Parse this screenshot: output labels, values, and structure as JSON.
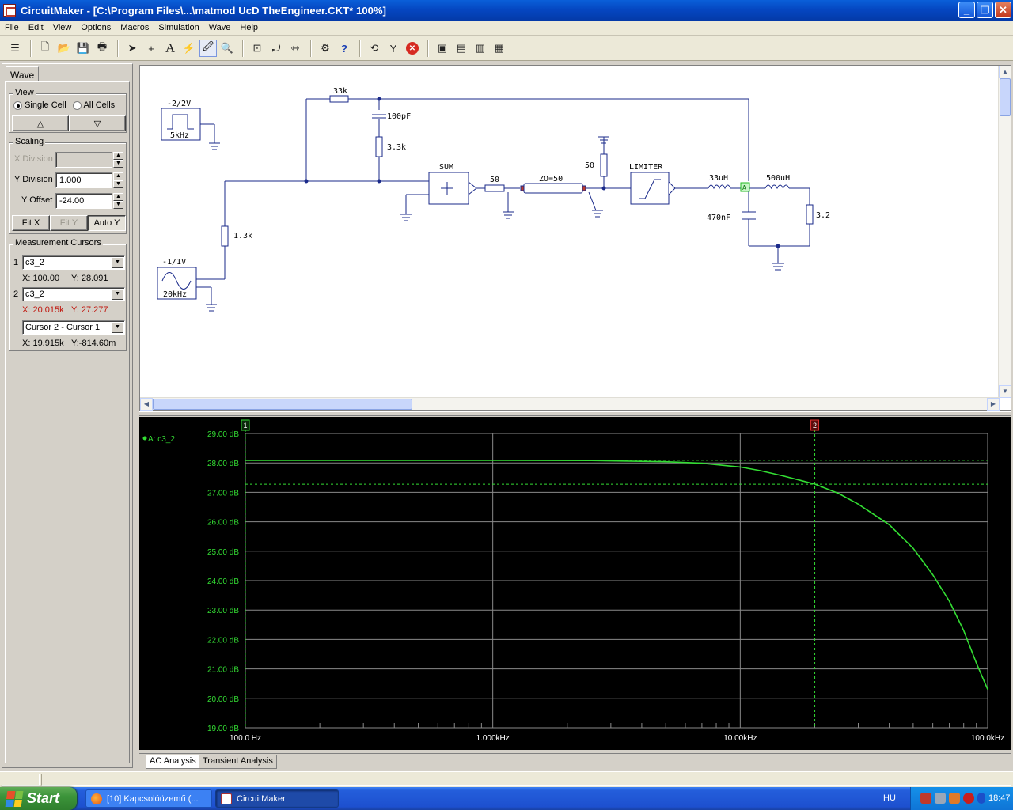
{
  "window": {
    "title": "CircuitMaker - [C:\\Program Files\\...\\matmod UcD TheEngineer.CKT* 100%]",
    "min_icon": "minimize-icon",
    "max_icon": "restore-icon",
    "close_icon": "close-icon"
  },
  "menu": [
    "File",
    "Edit",
    "View",
    "Options",
    "Macros",
    "Simulation",
    "Wave",
    "Help"
  ],
  "left_panel": {
    "tab": "Wave",
    "view": {
      "legend": "View",
      "single_cell": "Single Cell",
      "all_cells": "All Cells",
      "selected": "Single Cell",
      "up": "△",
      "down": "▽"
    },
    "scaling": {
      "legend": "Scaling",
      "x_division_label": "X Division",
      "x_division_value": "",
      "y_division_label": "Y Division",
      "y_division_value": "1.000",
      "y_offset_label": "Y Offset",
      "y_offset_value": "-24.00",
      "fit_x": "Fit X",
      "fit_y": "Fit Y",
      "auto_y": "Auto Y"
    },
    "cursors": {
      "legend": "Measurement Cursors",
      "c1_num": "1",
      "c1_trace": "c3_2",
      "c1_x": "X: 100.00",
      "c1_y": "Y: 28.091",
      "c2_num": "2",
      "c2_trace": "c3_2",
      "c2_x": "X: 20.015k",
      "c2_y": "Y: 27.277",
      "diff_mode": "Cursor 2 - Cursor 1",
      "diff_x": "X: 19.915k",
      "diff_y": "Y:-814.60m"
    }
  },
  "schematic": {
    "src1_label": "-2/2V",
    "src1_freq": "5kHz",
    "src2_label": "-1/1V",
    "src2_freq": "20kHz",
    "r_33k": "33k",
    "c_100pf": "100pF",
    "r_3_3k": "3.3k",
    "r_1_3k": "1.3k",
    "sum_label": "SUM",
    "r_50a": "50",
    "tline": "ZO=50",
    "r_50b": "50",
    "limiter": "LIMITER",
    "l_33uh": "33uH",
    "l_500uh": "500uH",
    "c_470nf": "470nF",
    "r_3_2": "3.2",
    "probe": "A"
  },
  "plot": {
    "trace_legend": "A: c3_2",
    "cursor1_tag": "1",
    "cursor2_tag": "2",
    "colors": {
      "trace": "#33dd33",
      "grid": "#8a8a8a",
      "label": "#33dd33",
      "cursor1": "#33dd33",
      "cursor2": "#e03030"
    }
  },
  "chart_data": {
    "type": "line",
    "xscale": "log",
    "xlim": [
      100,
      100000
    ],
    "ylim": [
      19,
      29
    ],
    "x_ticks": [
      "100.0 Hz",
      "1.000kHz",
      "10.00kHz",
      "100.0kHz"
    ],
    "y_ticks": [
      "29.00 dB",
      "28.00 dB",
      "27.00 dB",
      "26.00 dB",
      "25.00 dB",
      "24.00 dB",
      "23.00 dB",
      "22.00 dB",
      "21.00 dB",
      "20.00 dB",
      "19.00 dB"
    ],
    "series": [
      {
        "name": "A: c3_2",
        "x": [
          100,
          1000,
          2500,
          5000,
          7000,
          10000,
          12000,
          15000,
          20015,
          25000,
          30000,
          40000,
          50000,
          60000,
          70000,
          80000,
          90000,
          100000
        ],
        "y": [
          28.09,
          28.09,
          28.08,
          28.04,
          27.99,
          27.86,
          27.74,
          27.55,
          27.28,
          26.96,
          26.6,
          25.9,
          25.1,
          24.2,
          23.3,
          22.3,
          21.2,
          20.3
        ]
      }
    ],
    "cursors": [
      {
        "x": 100,
        "y": 28.091
      },
      {
        "x": 20015,
        "y": 27.277
      }
    ]
  },
  "bottom_tabs": [
    "AC Analysis",
    "Transient Analysis"
  ],
  "taskbar": {
    "start": "Start",
    "task1": "[10] Kapcsolóüzemű (...",
    "task2": "CircuitMaker",
    "lang": "HU",
    "clock": "18:47"
  }
}
